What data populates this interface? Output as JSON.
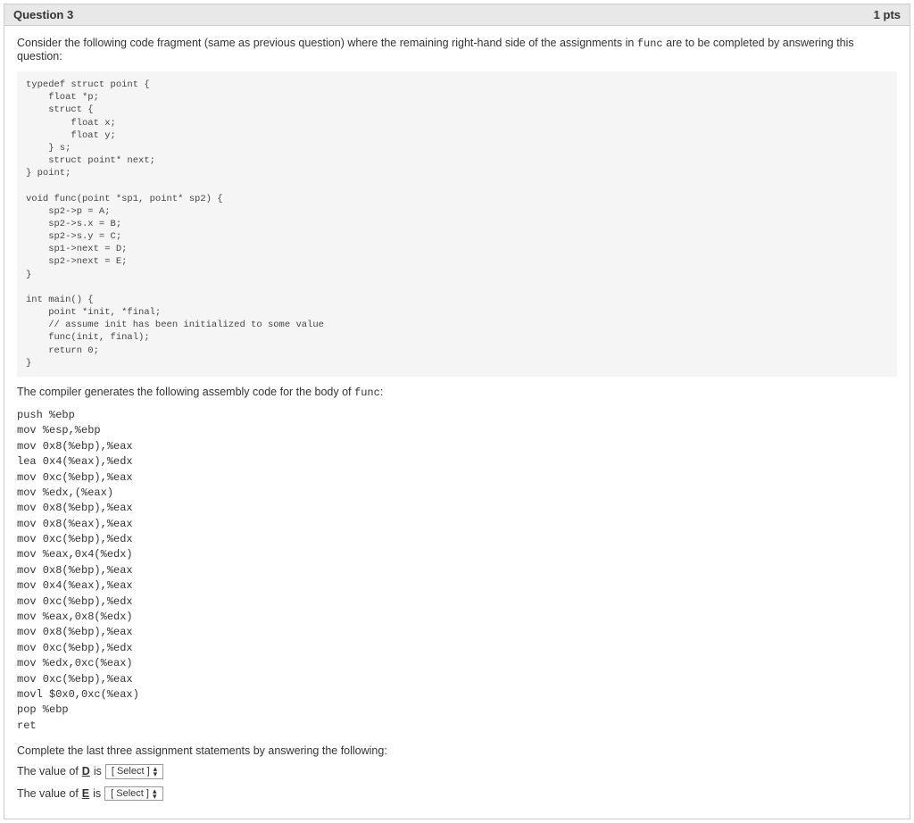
{
  "header": {
    "title": "Question 3",
    "points": "1 pts"
  },
  "intro": {
    "prefix": "Consider the following code fragment (same as previous question) where the remaining right-hand side of the assignments in ",
    "code_ref": "func",
    "suffix": " are to be completed by answering this question:"
  },
  "code_fragment": "typedef struct point {\n    float *p;\n    struct {\n        float x;\n        float y;\n    } s;\n    struct point* next;\n} point;\n\nvoid func(point *sp1, point* sp2) {\n    sp2->p = A;\n    sp2->s.x = B;\n    sp2->s.y = C;\n    sp1->next = D;\n    sp2->next = E;\n}\n\nint main() {\n    point *init, *final;\n    // assume init has been initialized to some value\n    func(init, final);\n    return 0;\n}",
  "compiler_text": {
    "prefix": "The compiler generates the following assembly code for the body of ",
    "code_ref": "func",
    "suffix": ":"
  },
  "assembly": "push %ebp\nmov %esp,%ebp\nmov 0x8(%ebp),%eax\nlea 0x4(%eax),%edx\nmov 0xc(%ebp),%eax\nmov %edx,(%eax)\nmov 0x8(%ebp),%eax\nmov 0x8(%eax),%eax\nmov 0xc(%ebp),%edx\nmov %eax,0x4(%edx)\nmov 0x8(%ebp),%eax\nmov 0x4(%eax),%eax\nmov 0xc(%ebp),%edx\nmov %eax,0x8(%edx)\nmov 0x8(%ebp),%eax\nmov 0xc(%ebp),%edx\nmov %edx,0xc(%eax)\nmov 0xc(%ebp),%eax\nmovl $0x0,0xc(%eax)\npop %ebp\nret",
  "complete_text": "Complete the last three assignment statements by answering the following:",
  "answer_d": {
    "prefix": "The value of ",
    "var": "D",
    "mid": " is ",
    "select": "[ Select ]"
  },
  "answer_e": {
    "prefix": "The value of ",
    "var": "E",
    "mid": " is ",
    "select": "[ Select ]"
  }
}
